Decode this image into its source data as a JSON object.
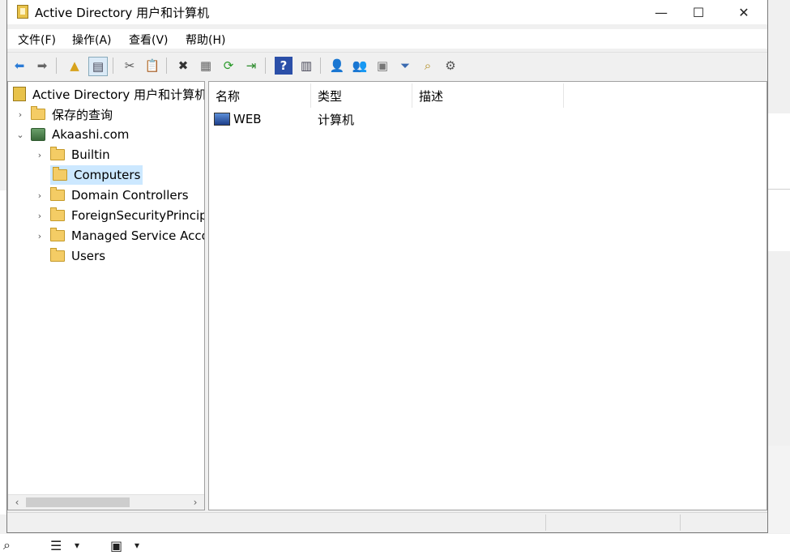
{
  "window": {
    "title": "Active Directory 用户和计算机",
    "minimize_glyph": "—",
    "maximize_glyph": "☐",
    "close_glyph": "✕"
  },
  "menu": [
    "文件(F)",
    "操作(A)",
    "查看(V)",
    "帮助(H)"
  ],
  "toolbar": {
    "buttons": [
      "back-icon",
      "forward-icon",
      "up-folder-icon",
      "show-tree-icon",
      "cut-icon",
      "paste-icon",
      "delete-icon",
      "properties-icon",
      "refresh-icon",
      "export-icon",
      "help-icon",
      "show-pane-icon",
      "new-user-icon",
      "new-group-icon",
      "new-ou-icon",
      "filter-icon",
      "find-icon",
      "add-to-group-icon"
    ]
  },
  "tree": {
    "root": "Active Directory 用户和计算机",
    "items": [
      {
        "label": "保存的查询",
        "indent": 1,
        "expander": "›"
      },
      {
        "label": "Akaashi.com",
        "indent": 1,
        "expander": "⌄"
      },
      {
        "label": "Builtin",
        "indent": 2,
        "expander": "›"
      },
      {
        "label": "Computers",
        "indent": 2,
        "expander": "",
        "selected": true
      },
      {
        "label": "Domain Controllers",
        "indent": 2,
        "expander": "›"
      },
      {
        "label": "ForeignSecurityPrincipa",
        "indent": 2,
        "expander": "›"
      },
      {
        "label": "Managed Service Acco",
        "indent": 2,
        "expander": "›"
      },
      {
        "label": "Users",
        "indent": 2,
        "expander": ""
      }
    ]
  },
  "list": {
    "columns": [
      "名称",
      "类型",
      "描述"
    ],
    "rows": [
      {
        "name": "WEB",
        "type": "计算机",
        "description": ""
      }
    ]
  },
  "scroll": {
    "left_arrow": "‹",
    "right_arrow": "›"
  },
  "taskbar": {
    "search_glyph": "⌕",
    "icon1": "☰",
    "icon2": "▣",
    "dropdown_glyph": "▾"
  }
}
